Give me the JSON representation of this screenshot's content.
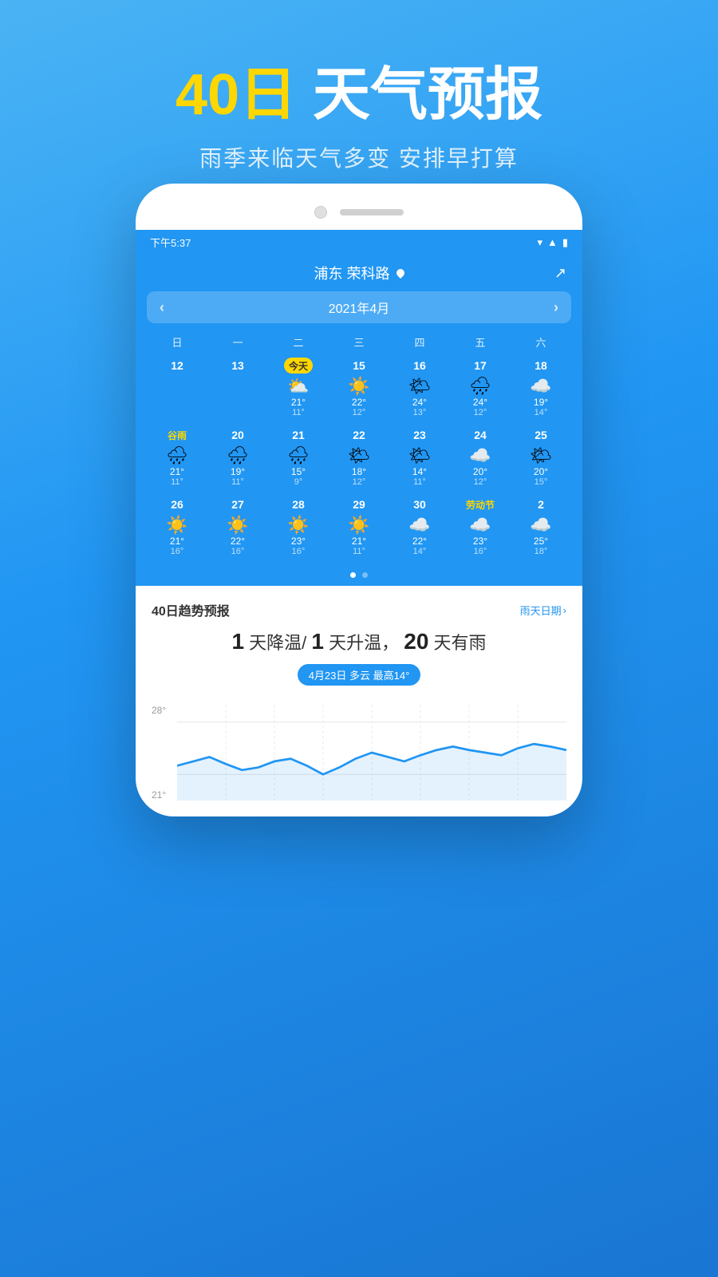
{
  "hero": {
    "title_yellow": "40日",
    "title_white": "天气预报",
    "subtitle": "雨季来临天气多变 安排早打算"
  },
  "phone": {
    "status_time": "下午5:37",
    "location": "浦东 荣科路",
    "calendar_month": "2021年4月",
    "share_icon": "↗",
    "day_headers": [
      "日",
      "一",
      "二",
      "三",
      "四",
      "五",
      "六"
    ],
    "weeks": [
      [
        {
          "num": "12",
          "icon": "",
          "high": "",
          "low": "",
          "empty": true
        },
        {
          "num": "13",
          "icon": "",
          "high": "",
          "low": "",
          "empty": true
        },
        {
          "num": "今天",
          "today": true,
          "icon": "⛅",
          "high": "21°",
          "low": "11°"
        },
        {
          "num": "15",
          "icon": "☀️",
          "high": "22°",
          "low": "12°"
        },
        {
          "num": "16",
          "icon": "🌤",
          "high": "24°",
          "low": "13°"
        },
        {
          "num": "17",
          "icon": "🌧",
          "high": "24°",
          "low": "12°"
        },
        {
          "num": "18",
          "icon": "☁️",
          "high": "19°",
          "low": "14°"
        }
      ],
      [
        {
          "num": "谷雨",
          "special": true,
          "icon": "🌧",
          "high": "21°",
          "low": "11°"
        },
        {
          "num": "20",
          "icon": "🌧",
          "high": "19°",
          "low": "11°"
        },
        {
          "num": "21",
          "icon": "🌧",
          "high": "15°",
          "low": "9°"
        },
        {
          "num": "22",
          "icon": "🌤",
          "high": "18°",
          "low": "12°"
        },
        {
          "num": "23",
          "icon": "🌤",
          "high": "14°",
          "low": "11°"
        },
        {
          "num": "24",
          "icon": "☁️",
          "high": "20°",
          "low": "12°"
        },
        {
          "num": "25",
          "icon": "🌤",
          "high": "20°",
          "low": "15°"
        }
      ],
      [
        {
          "num": "26",
          "icon": "☀️",
          "high": "21°",
          "low": "16°"
        },
        {
          "num": "27",
          "icon": "☀️",
          "high": "22°",
          "low": "16°"
        },
        {
          "num": "28",
          "icon": "☀️",
          "high": "23°",
          "low": "16°"
        },
        {
          "num": "29",
          "icon": "☀️",
          "high": "21°",
          "low": "11°"
        },
        {
          "num": "30",
          "icon": "☁️",
          "high": "22°",
          "low": "14°"
        },
        {
          "num": "劳动节",
          "special": true,
          "icon": "☁️",
          "high": "23°",
          "low": "16°"
        },
        {
          "num": "2",
          "icon": "☁️",
          "high": "25°",
          "low": "18°"
        }
      ]
    ],
    "dots": [
      true,
      false
    ]
  },
  "trend": {
    "title": "40日趋势预报",
    "link_text": "雨天日期",
    "summary_text": "天降温/",
    "summary_bold1": "1",
    "summary_text2": "天升温，",
    "summary_bold2": "20",
    "summary_text3": "天有雨",
    "tag": "4月23日 多云 最高14°",
    "chart": {
      "y_labels": [
        "28°",
        "21°"
      ],
      "line_points": "0,90 20,85 40,75 60,80 80,70 100,65 120,72 140,68 160,80 180,85 200,78 220,72 240,68 260,75 280,72 300,65 320,60 340,55 360,58 380,62 400,65 420,60 440,55 460,52 480,55"
    }
  }
}
